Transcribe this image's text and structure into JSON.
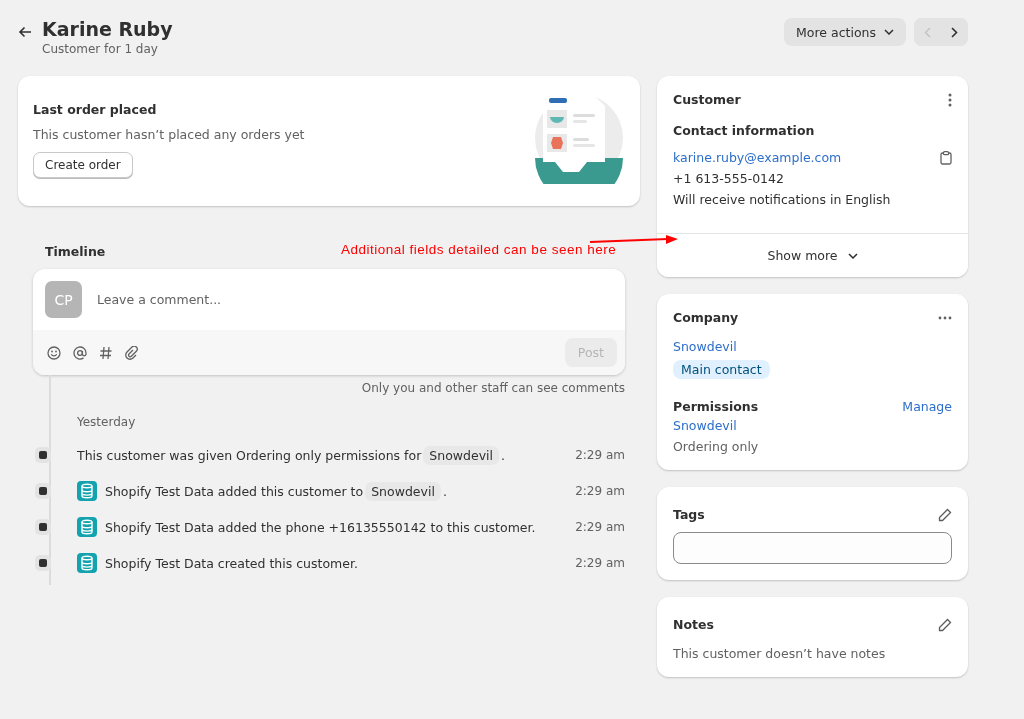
{
  "header": {
    "title": "Karine Ruby",
    "subtitle": "Customer for 1 day",
    "more_actions": "More actions",
    "pager": [
      {
        "kind": "previous",
        "disabled": true
      },
      {
        "kind": "next",
        "disabled": false
      }
    ]
  },
  "last_order": {
    "title": "Last order placed",
    "text": "This customer hasn’t placed any orders yet",
    "button": "Create order"
  },
  "timeline": {
    "title": "Timeline",
    "avatar": "CP",
    "comment_placeholder": "Leave a comment...",
    "post_button": {
      "label": "Post",
      "disabled": true
    },
    "note": "Only you and other staff can see comments",
    "date": "Yesterday",
    "events": [
      {
        "kind": "system",
        "text": "This customer was given Ordering only permissions for ",
        "chip": "Snowdevil",
        "suffix": ".",
        "time": "2:29 am"
      },
      {
        "kind": "app",
        "text": "Shopify Test Data added this customer to ",
        "chip": "Snowdevil",
        "suffix": ".",
        "time": "2:29 am"
      },
      {
        "kind": "app",
        "text": "Shopify Test Data added the phone +16135550142 to this customer.",
        "time": "2:29 am"
      },
      {
        "kind": "app",
        "text": "Shopify Test Data created this customer.",
        "time": "2:29 am"
      }
    ]
  },
  "customer": {
    "title": "Customer",
    "contact_title": "Contact information",
    "email": "karine.ruby@example.com",
    "phone": "+1 613-555-0142",
    "language": "Will receive notifications in English",
    "show_more": "Show more"
  },
  "company": {
    "title": "Company",
    "name": "Snowdevil",
    "badge": "Main contact",
    "permissions_title": "Permissions",
    "manage": "Manage",
    "permissions_company": "Snowdevil",
    "permissions_level": "Ordering only"
  },
  "tags": {
    "title": "Tags"
  },
  "notes": {
    "title": "Notes",
    "text": "This customer doesn’t have notes"
  },
  "annotation": {
    "text": "Additional fields detailed can be seen here"
  }
}
